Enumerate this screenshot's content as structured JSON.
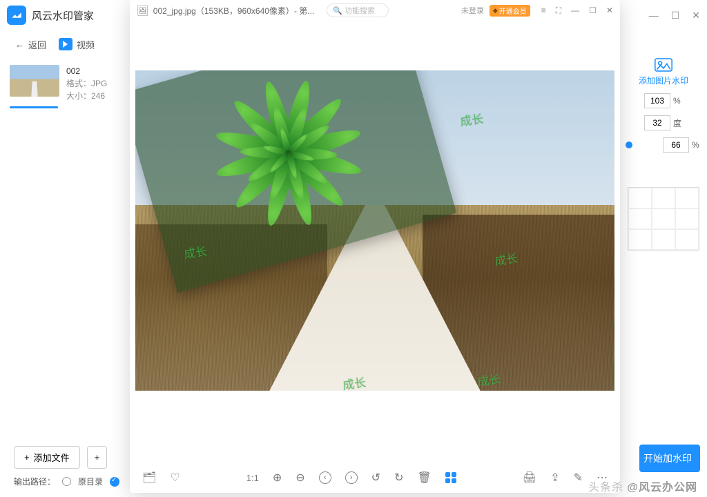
{
  "outer": {
    "app_title": "风云水印管家",
    "back_label": "返回",
    "video_label": "视频",
    "add_file_label": "添加文件",
    "output_path_label": "输出路径：",
    "original_dir_label": "原目录",
    "start_btn_label": "开始加水印"
  },
  "file": {
    "name": "002",
    "format_label": "格式：",
    "format_value": "JPG",
    "size_label": "大小：",
    "size_value": "246"
  },
  "sidebar": {
    "add_image_wm_label": "添加图片水印",
    "val_scale": "103",
    "unit_scale": "%",
    "val_rotate": "32",
    "unit_rotate": "度",
    "val_opacity": "66",
    "unit_opacity": "%"
  },
  "viewer": {
    "title": "002_jpg.jpg（153KB，960x640像素）- 第...",
    "search_placeholder": "功能搜索",
    "login_label": "未登录",
    "vip_label": "开通会员",
    "one_to_one": "1:1"
  },
  "watermark_text": "成长",
  "credit": {
    "prefix": "头条杀 ",
    "brand": "@风云办公网"
  }
}
